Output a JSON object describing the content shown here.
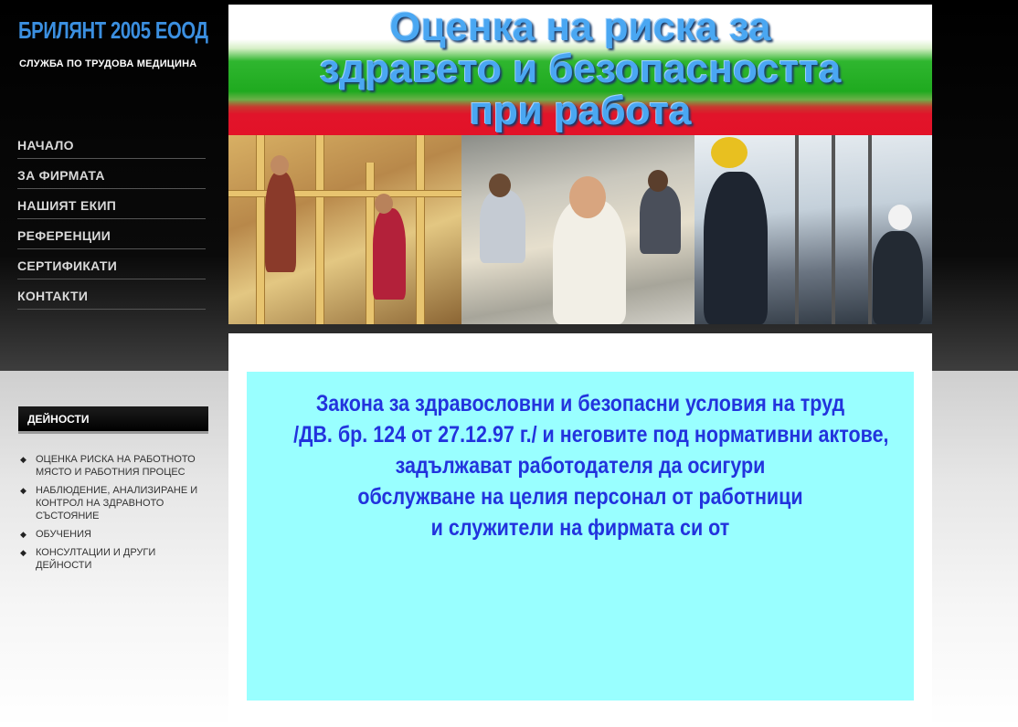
{
  "logo": {
    "title": "БРИЛЯНТ 2005 ЕООД",
    "subtitle": "СЛУЖБА ПО ТРУДОВА МЕДИЦИНА"
  },
  "nav": {
    "items": [
      {
        "label": "НАЧАЛО"
      },
      {
        "label": "ЗА ФИРМАТА"
      },
      {
        "label": "НАШИЯТ ЕКИП"
      },
      {
        "label": "РЕФЕРЕНЦИИ"
      },
      {
        "label": "СЕРТИФИКАТИ"
      },
      {
        "label": "КОНТАКТИ"
      }
    ]
  },
  "banner": {
    "lines": [
      "Оценка на риска за",
      "здравето и безопасността",
      "при работа"
    ],
    "colors": {
      "white": "#ffffff",
      "green": "#1faa1f",
      "red": "#e31228",
      "title": "#4aa7f2"
    }
  },
  "activities": {
    "heading": "ДЕЙНОСТИ",
    "items": [
      {
        "label": "ОЦЕНКА РИСКА НА РАБОТНОТО МЯСТО И РАБОТНИЯ ПРОЦЕС"
      },
      {
        "label": "НАБЛЮДЕНИЕ, АНАЛИЗИРАНЕ И КОНТРОЛ НА ЗДРАВНОТО СЪСТОЯНИЕ"
      },
      {
        "label": "ОБУЧЕНИЯ"
      },
      {
        "label": "КОНСУЛТАЦИИ И ДРУГИ ДЕЙНОСТИ"
      }
    ],
    "bullet_icon": "diamond-bullet-icon"
  },
  "notice": {
    "lines": [
      "Закона за здравословни и безопасни условия на труд",
      "/ДВ. бр. 124 от 27.12.97 г./ и неговите под нормативни актове,",
      "задължават работодателя да осигури",
      "обслужване на целия персонал от работници",
      "и служители на фирмата си от"
    ],
    "background": "#99ffff",
    "text_color": "#2233dd"
  }
}
